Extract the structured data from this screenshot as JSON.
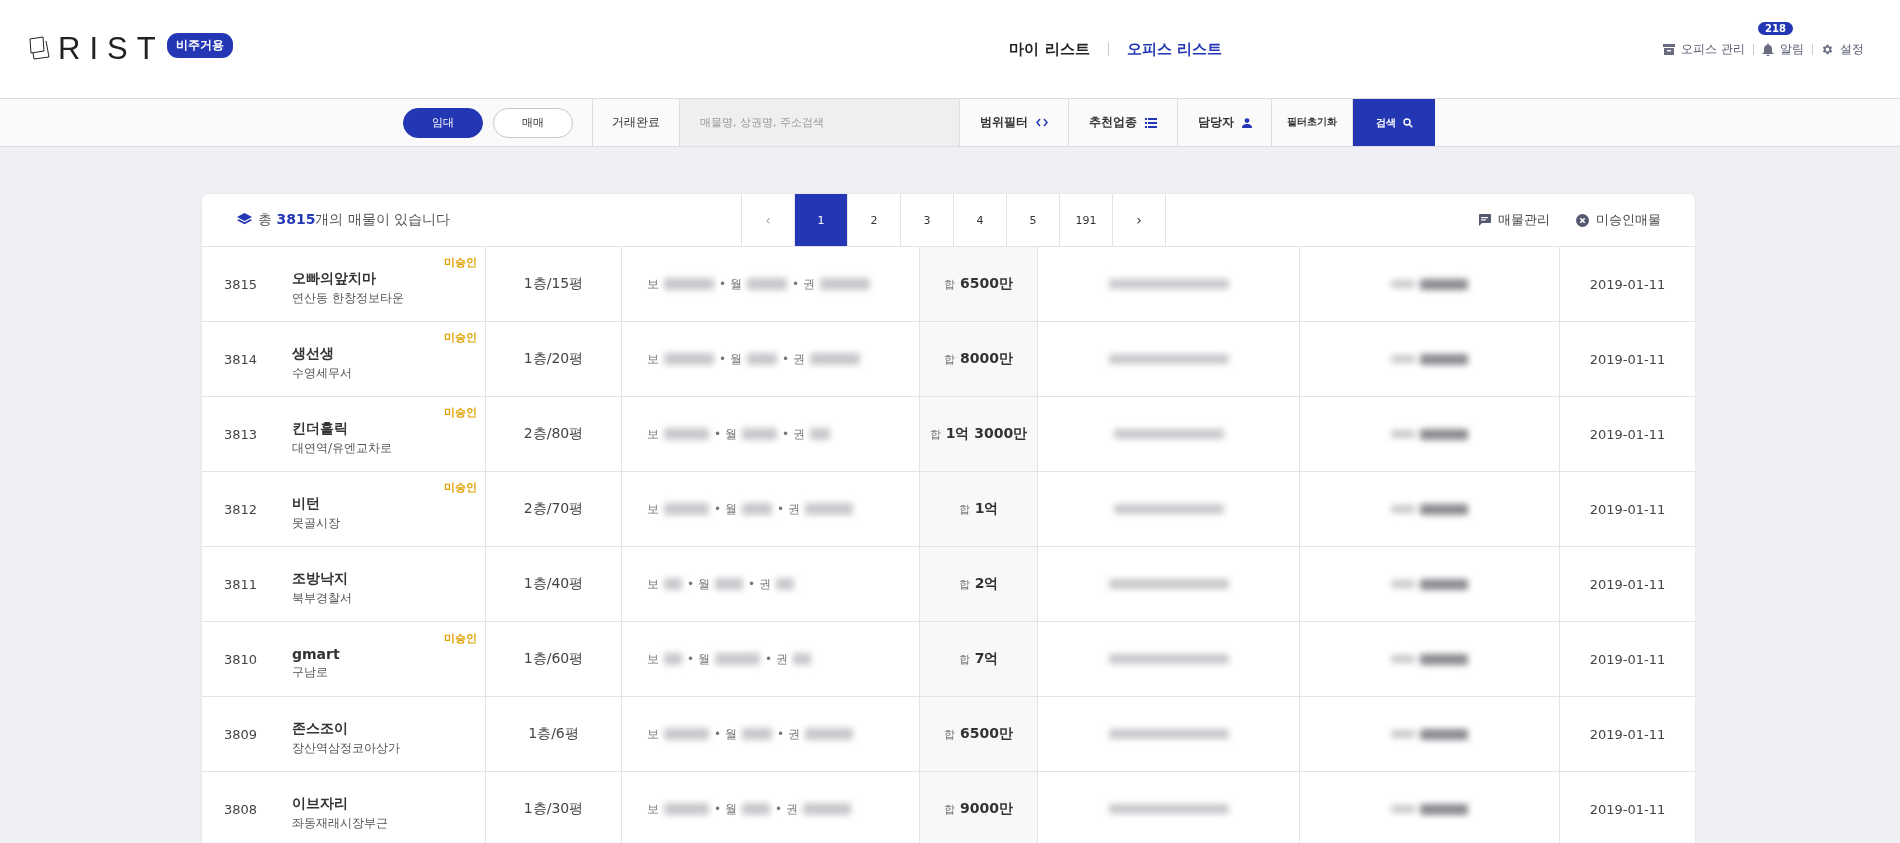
{
  "header": {
    "logo_text": "RIST",
    "logo_badge": "비주거용",
    "nav": [
      {
        "label": "마이 리스트",
        "selected": false
      },
      {
        "label": "오피스 리스트",
        "selected": true
      }
    ],
    "actions": [
      {
        "kind": "office",
        "label": "오피스 관리"
      },
      {
        "kind": "alert",
        "label": "알림",
        "badge": "218"
      },
      {
        "kind": "settings",
        "label": "설정"
      }
    ]
  },
  "filter_bar": {
    "deal_types": [
      {
        "label": "임대",
        "selected": true
      },
      {
        "label": "매매",
        "selected": false
      }
    ],
    "completed_label": "거래완료",
    "search": {
      "placeholder": "매물명, 상권명, 주소검색"
    },
    "filters": [
      {
        "kind": "range",
        "label": "범위필터"
      },
      {
        "kind": "category",
        "label": "추천업종"
      },
      {
        "kind": "manager",
        "label": "담당자"
      }
    ],
    "reset_label": "필터초기화",
    "search_button": "검색"
  },
  "listing": {
    "summary": {
      "prefix": "총 ",
      "count": "3815",
      "suffix": "개의 매물이 있습니다"
    },
    "pagination": {
      "prev": "‹",
      "next": "›",
      "pages": [
        {
          "label": "1",
          "selected": true
        },
        {
          "label": "2",
          "selected": false
        },
        {
          "label": "3",
          "selected": false
        },
        {
          "label": "4",
          "selected": false
        },
        {
          "label": "5",
          "selected": false
        },
        {
          "label": "191",
          "selected": false
        }
      ]
    },
    "tools": [
      {
        "kind": "manage",
        "label": "매물관리"
      },
      {
        "kind": "unapproved",
        "label": "미승인매물"
      }
    ],
    "rows": [
      {
        "no": "3815",
        "name": "오빠의앞치마",
        "area": "연산동 한창정보타운",
        "badge": "미승인",
        "floor": "1층/15평",
        "price_labels": [
          "보",
          "• 월",
          "• 권"
        ],
        "total_label": "합",
        "total": "6500만",
        "date": "2019-01-11"
      },
      {
        "no": "3814",
        "name": "생선생",
        "area": "수영세무서",
        "badge": "미승인",
        "floor": "1층/20평",
        "price_labels": [
          "보",
          "• 월",
          "• 권"
        ],
        "total_label": "합",
        "total": "8000만",
        "date": "2019-01-11"
      },
      {
        "no": "3813",
        "name": "킨더홀릭",
        "area": "대연역/유엔교차로",
        "badge": "미승인",
        "floor": "2층/80평",
        "price_labels": [
          "보",
          "• 월",
          "• 권"
        ],
        "total_label": "합",
        "total": "1억 3000만",
        "date": "2019-01-11"
      },
      {
        "no": "3812",
        "name": "비턴",
        "area": "못골시장",
        "badge": "미승인",
        "floor": "2층/70평",
        "price_labels": [
          "보",
          "• 월",
          "• 권"
        ],
        "total_label": "합",
        "total": "1억",
        "date": "2019-01-11"
      },
      {
        "no": "3811",
        "name": "조방낙지",
        "area": "북부경찰서",
        "floor": "1층/40평",
        "price_labels": [
          "보",
          "• 월",
          "• 권"
        ],
        "total_label": "합",
        "total": "2억",
        "date": "2019-01-11"
      },
      {
        "no": "3810",
        "name": "gmart",
        "area": "구남로",
        "badge": "미승인",
        "floor": "1층/60평",
        "price_labels": [
          "보",
          "• 월",
          "• 권"
        ],
        "total_label": "합",
        "total": "7억",
        "date": "2019-01-11"
      },
      {
        "no": "3809",
        "name": "존스조이",
        "area": "장산역삼정코아상가",
        "floor": "1층/6평",
        "price_labels": [
          "보",
          "• 월",
          "• 권"
        ],
        "total_label": "합",
        "total": "6500만",
        "date": "2019-01-11"
      },
      {
        "no": "3808",
        "name": "이브자리",
        "area": "좌동재래시장부근",
        "floor": "1층/30평",
        "price_labels": [
          "보",
          "• 월",
          "• 권"
        ],
        "total_label": "합",
        "total": "9000만",
        "date": "2019-01-11"
      }
    ]
  }
}
